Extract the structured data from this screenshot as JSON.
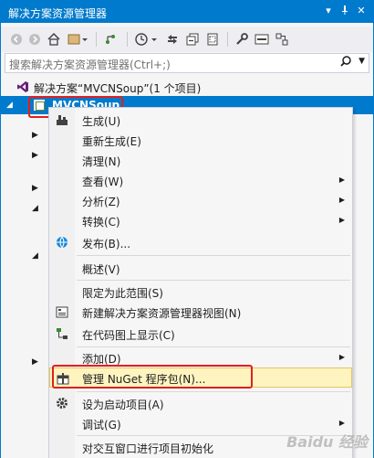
{
  "window": {
    "title": "解决方案资源管理器",
    "pin_glyph": "▾",
    "dock_glyph": "⊣",
    "close_glyph": "✕"
  },
  "toolbar": {
    "items": [
      "back-icon",
      "forward-icon",
      "home-icon",
      "switch-views-icon",
      "pending-changes-icon",
      "history-icon",
      "sync-icon",
      "collapse-icon",
      "show-all-icon",
      "properties-icon",
      "preview-icon",
      "graph-icon"
    ]
  },
  "search": {
    "placeholder": "搜索解决方案资源管理器(Ctrl+;)"
  },
  "tree": {
    "solution_label": "解决方案“MVCNSoup”(1 个项目)",
    "project_label": "MVCNSoup"
  },
  "context_menu": {
    "items": [
      {
        "label": "生成(U)",
        "icon": "build-icon"
      },
      {
        "label": "重新生成(E)"
      },
      {
        "label": "清理(N)"
      },
      {
        "label": "查看(W)",
        "submenu": true
      },
      {
        "label": "分析(Z)",
        "submenu": true
      },
      {
        "label": "转换(C)",
        "submenu": true
      },
      {
        "label": "发布(B)...",
        "icon": "publish-globe-icon"
      },
      {
        "label": "概述(V)"
      },
      {
        "label": "限定为此范围(S)"
      },
      {
        "label": "新建解决方案资源管理器视图(N)",
        "icon": "new-view-icon"
      },
      {
        "label": "在代码图上显示(C)",
        "icon": "code-map-icon"
      },
      {
        "label": "添加(D)",
        "submenu": true
      },
      {
        "label": "管理 NuGet 程序包(N)...",
        "icon": "nuget-package-icon"
      },
      {
        "label": "设为启动项目(A)",
        "icon": "gear-icon"
      },
      {
        "label": "调试(G)",
        "submenu": true
      },
      {
        "label": "对交互窗口进行项目初始化"
      }
    ]
  },
  "watermark": "Baidu 经验",
  "colors": {
    "accent": "#007acc",
    "highlight_border": "#e02020",
    "hover_bg": "#fdf4bf"
  }
}
